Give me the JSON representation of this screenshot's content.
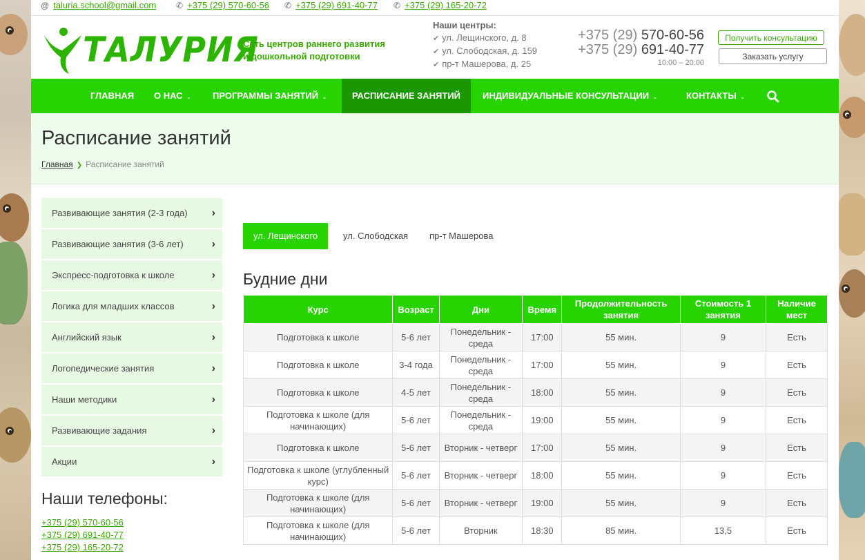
{
  "topbar": {
    "email": "taluria.school@gmail.com",
    "phones": [
      "+375 (29) 570-60-56",
      "+375 (29) 691-40-77",
      "+375 (29) 165-20-72"
    ]
  },
  "header": {
    "logo_text": "ТАЛУРИЯ",
    "tagline_1": "Сеть центров раннего развития",
    "tagline_2": "и дошкольной подготовки",
    "centers_title": "Наши центры:",
    "centers": [
      "ул. Лещинского, д. 8",
      "ул. Слободская, д. 159",
      "пр-т Машерова, д. 25"
    ],
    "phone_1_code": "+375 (29)",
    "phone_1_num": "570-60-56",
    "phone_2_code": "+375 (29)",
    "phone_2_num": "691-40-77",
    "hours": "10:00 – 20:00",
    "consult_button": "Получить консультацию",
    "order_button": "Заказать услугу"
  },
  "nav": {
    "home": "Главная",
    "about": "О нас",
    "programs": "Программы занятий",
    "schedule": "Расписание занятий",
    "consultations": "Индивидуальные консультации",
    "contacts": "Контакты"
  },
  "page": {
    "title": "Расписание занятий",
    "breadcrumb_home": "Главная",
    "breadcrumb_current": "Расписание занятий"
  },
  "sidebar": {
    "items": [
      "Развивающие занятия (2-3 года)",
      "Развивающие занятия (3-6 лет)",
      "Экспресс-подготовка к школе",
      "Логика для младших классов",
      "Английский язык",
      "Логопедические занятия",
      "Наши методики",
      "Развивающие задания",
      "Акции"
    ],
    "phones_title": "Наши телефоны:",
    "phones": [
      "+375 (29) 570-60-56",
      "+375 (29) 691-40-77",
      "+375 (29) 165-20-72"
    ]
  },
  "tabs": [
    "ул. Лещинского",
    "ул. Слободская",
    "пр-т Машерова"
  ],
  "section_title": "Будние дни",
  "table": {
    "headers": [
      "Курс",
      "Возраст",
      "Дни",
      "Время",
      "Продолжительность занятия",
      "Стоимость 1 занятия",
      "Наличие мест"
    ],
    "rows": [
      [
        "Подготовка к школе",
        "5-6 лет",
        "Понедельник - среда",
        "17:00",
        "55 мин.",
        "9",
        "Есть"
      ],
      [
        "Подготовка к школе",
        "3-4 года",
        "Понедельник - среда",
        "17:00",
        "55 мин.",
        "9",
        "Есть"
      ],
      [
        "Подготовка к школе",
        "4-5 лет",
        "Понедельник - среда",
        "18:00",
        "55 мин.",
        "9",
        "Есть"
      ],
      [
        "Подготовка к школе (для начинающих)",
        "5-6 лет",
        "Понедельник - среда",
        "19:00",
        "55 мин.",
        "9",
        "Есть"
      ],
      [
        "Подготовка к школе",
        "5-6 лет",
        "Вторник - четверг",
        "17:00",
        "55 мин.",
        "9",
        "Есть"
      ],
      [
        "Подготовка к школе (углубленный курс)",
        "5-6 лет",
        "Вторник - четверг",
        "18:00",
        "55 мин.",
        "9",
        "Есть"
      ],
      [
        "Подготовка к школе (для начинающих)",
        "5-6 лет",
        "Вторник - четверг",
        "19:00",
        "55 мин.",
        "9",
        "Есть"
      ],
      [
        "Подготовка к школе (для начинающих)",
        "5-6 лет",
        "Вторник",
        "18:30",
        "85 мин.",
        "13,5",
        "Есть"
      ]
    ]
  },
  "colors": {
    "brand_green": "#27d300",
    "active_nav": "#1b9800",
    "link_green": "#3aa800"
  }
}
